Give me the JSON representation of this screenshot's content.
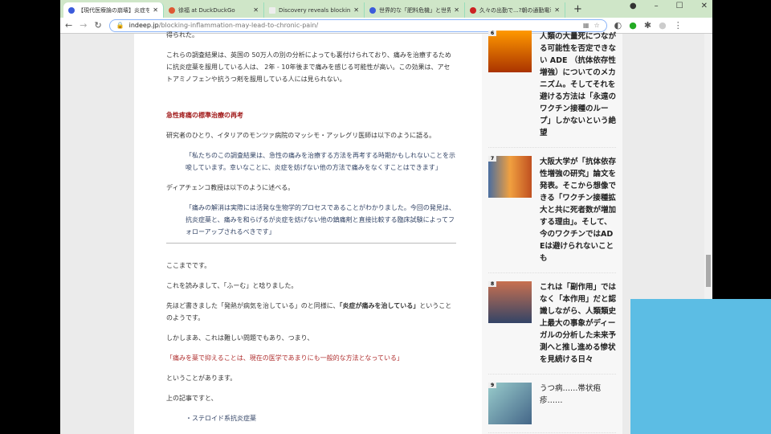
{
  "tabs": [
    {
      "label": "【現代医療論の崩壊】炎症を止め",
      "active": true
    },
    {
      "label": "徐福 at DuckDuckGo"
    },
    {
      "label": "Discovery reveals blocking inflam"
    },
    {
      "label": "世界的な「肥料危機」と世界経済"
    },
    {
      "label": "久々の出勤で...?朝の通勤電車で"
    }
  ],
  "url": {
    "domain": "indeep.jp",
    "path": "/blocking-inflammation-may-lead-to-chronic-pain/"
  },
  "article": {
    "p0": "得られた。",
    "p1": "これらの調査結果は、英国の 50万人の別の分析によっても裏付けられており、痛みを治療するために抗炎症薬を服用している人は、 2年 - 10年後まで痛みを感じる可能性が高い。この効果は、アセトアミノフェンや抗うつ剤を服用している人には見られない。",
    "heading": "急性疼痛の標準治療の再考",
    "p2": "研究者のひとり、イタリアのモンツァ病院のマッシモ・アッレグリ医師は以下のように語る。",
    "q1": "「私たちのこの調査結果は、急性の痛みを治療する方法を再考する時期かもしれないことを示唆しています。幸いなことに、炎症を妨げない他の方法で痛みをなくすことはできます」",
    "p3": "ディアチェンコ教授は以下のように述べる。",
    "q2": "「痛みの解消は実際には活発な生物学的プロセスであることがわかりました。今回の発見は、抗炎症薬と、痛みを和らげるが炎症を妨げない他の鎮痛剤と直接比較する臨床試験によってフォローアップされるべきです」",
    "p4": "ここまでです。",
    "p5": "これを読みまして、「ふーむ」と唸りました。",
    "p6a": "先ほど書きました「発熱が病気を治している」のと同様に、",
    "p6b": "「炎症が痛みを治している」",
    "p6c": "ということのようです。",
    "p7": "しかしまあ、これは難しい問題でもあり、つまり、",
    "p8": "「痛みを薬で抑えることは、現在の医学であまりにも一般的な方法となっている」",
    "p9": "ということがあります。",
    "p10": "上の記事ですと、",
    "li1": "・ステロイド系抗炎症薬"
  },
  "sidebar": [
    {
      "num": "6",
      "text": "人類の大量死につながる可能性を否定できない ADE （抗体依存性増強）についてのメカニズム。そしてそれを避ける方法は「永遠のワクチン接種のループ」しかないという絶望"
    },
    {
      "num": "7",
      "text": "大阪大学が「抗体依存性増強の研究」論文を発表。そこから想像できる「ワクチン接種拡大と共に死者数が増加する理由」。そして、今のワクチンではADEは避けられないことも"
    },
    {
      "num": "8",
      "text": "これは「副作用」ではなく「本作用」だと認識しながら、人類類史上最大の事象がディーガルの分析した未来予測へと推し進める惨状を見続ける日々"
    },
    {
      "num": "9",
      "text": "うつ病……帯状疱疹……"
    }
  ]
}
